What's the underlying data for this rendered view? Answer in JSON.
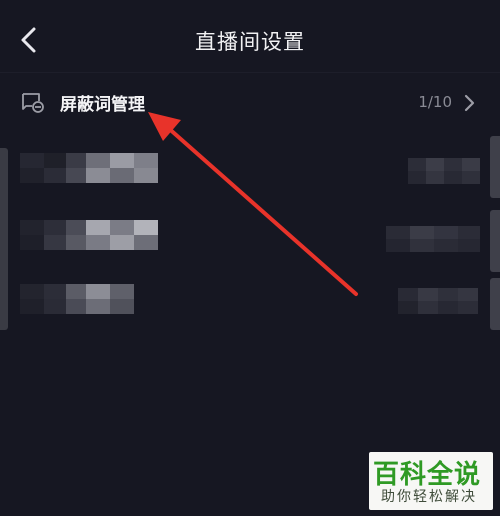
{
  "header": {
    "title": "直播间设置",
    "back_icon": "chevron-left-icon"
  },
  "setting_row": {
    "icon": "chat-block-icon",
    "label": "屏蔽词管理",
    "count": "1/10",
    "chevron": "chevron-right-icon"
  },
  "watermark": {
    "title": "百科全说",
    "subtitle": "助你轻松解决"
  },
  "colors": {
    "background": "#161722",
    "text": "#f1f1f3",
    "muted": "#8a8b95",
    "arrow": "#e8332a",
    "watermark_green": "#2f9a24"
  }
}
